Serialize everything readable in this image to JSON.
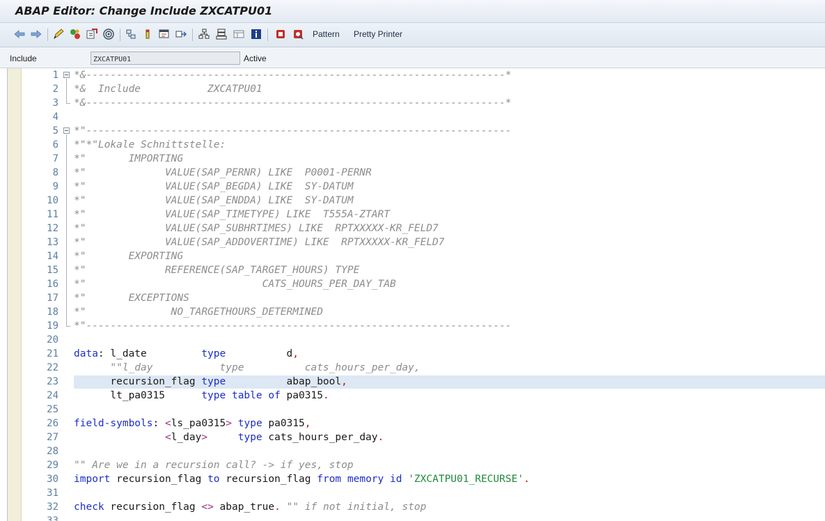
{
  "window": {
    "title": "ABAP Editor: Change Include ZXCATPU01"
  },
  "toolbar": {
    "pattern_label": "Pattern",
    "pretty_printer_label": "Pretty Printer"
  },
  "include": {
    "label": "Include",
    "name": "ZXCATPU01",
    "status": "Active"
  },
  "editor": {
    "lines": [
      {
        "n": "1",
        "fold": "open",
        "tokens": [
          [
            "cmt",
            "*&---------------------------------------------------------------------*"
          ]
        ]
      },
      {
        "n": "2",
        "tokens": [
          [
            "cmt",
            "*&  Include           ZXCATPU01"
          ]
        ]
      },
      {
        "n": "3",
        "fold": "end",
        "tokens": [
          [
            "cmt",
            "*&---------------------------------------------------------------------*"
          ]
        ]
      },
      {
        "n": "4",
        "tokens": []
      },
      {
        "n": "5",
        "fold": "open",
        "tokens": [
          [
            "cmt",
            "*\"----------------------------------------------------------------------"
          ]
        ]
      },
      {
        "n": "6",
        "tokens": [
          [
            "cmt",
            "*\"*\"Lokale Schnittstelle:"
          ]
        ]
      },
      {
        "n": "7",
        "tokens": [
          [
            "cmt",
            "*\"       IMPORTING"
          ]
        ]
      },
      {
        "n": "8",
        "tokens": [
          [
            "cmt",
            "*\"             VALUE(SAP_PERNR) LIKE  P0001-PERNR"
          ]
        ]
      },
      {
        "n": "9",
        "tokens": [
          [
            "cmt",
            "*\"             VALUE(SAP_BEGDA) LIKE  SY-DATUM"
          ]
        ]
      },
      {
        "n": "10",
        "tokens": [
          [
            "cmt",
            "*\"             VALUE(SAP_ENDDA) LIKE  SY-DATUM"
          ]
        ]
      },
      {
        "n": "11",
        "tokens": [
          [
            "cmt",
            "*\"             VALUE(SAP_TIMETYPE) LIKE  T555A-ZTART"
          ]
        ]
      },
      {
        "n": "12",
        "tokens": [
          [
            "cmt",
            "*\"             VALUE(SAP_SUBHRTIMES) LIKE  RPTXXXXX-KR_FELD7"
          ]
        ]
      },
      {
        "n": "13",
        "tokens": [
          [
            "cmt",
            "*\"             VALUE(SAP_ADDOVERTIME) LIKE  RPTXXXXX-KR_FELD7"
          ]
        ]
      },
      {
        "n": "14",
        "tokens": [
          [
            "cmt",
            "*\"       EXPORTING"
          ]
        ]
      },
      {
        "n": "15",
        "tokens": [
          [
            "cmt",
            "*\"             REFERENCE(SAP_TARGET_HOURS) TYPE"
          ]
        ]
      },
      {
        "n": "16",
        "tokens": [
          [
            "cmt",
            "*\"                             CATS_HOURS_PER_DAY_TAB"
          ]
        ]
      },
      {
        "n": "17",
        "tokens": [
          [
            "cmt",
            "*\"       EXCEPTIONS"
          ]
        ]
      },
      {
        "n": "18",
        "tokens": [
          [
            "cmt",
            "*\"              NO_TARGETHOURS_DETERMINED"
          ]
        ]
      },
      {
        "n": "19",
        "fold": "end",
        "tokens": [
          [
            "cmt",
            "*\"----------------------------------------------------------------------"
          ]
        ]
      },
      {
        "n": "20",
        "tokens": []
      },
      {
        "n": "21",
        "tokens": [
          [
            "kw",
            "data"
          ],
          [
            "tx",
            ": l_date         "
          ],
          [
            "kw",
            "type"
          ],
          [
            "tx",
            "          d"
          ],
          [
            "punc",
            ","
          ]
        ]
      },
      {
        "n": "22",
        "tokens": [
          [
            "cmt",
            "      \"\"l_day           type          cats_hours_per_day,"
          ]
        ]
      },
      {
        "n": "23",
        "highlight": true,
        "tokens": [
          [
            "tx",
            "      recursion_flag "
          ],
          [
            "kw",
            "type"
          ],
          [
            "tx",
            "          abap_bool"
          ],
          [
            "punc",
            ","
          ]
        ]
      },
      {
        "n": "24",
        "tokens": [
          [
            "tx",
            "      lt_pa0315      "
          ],
          [
            "kw",
            "type table of"
          ],
          [
            "tx",
            " pa0315"
          ],
          [
            "punc",
            "."
          ]
        ]
      },
      {
        "n": "25",
        "tokens": []
      },
      {
        "n": "26",
        "tokens": [
          [
            "kw",
            "field-symbols"
          ],
          [
            "tx",
            ": "
          ],
          [
            "op",
            "<"
          ],
          [
            "tx",
            "ls_pa0315"
          ],
          [
            "op",
            ">"
          ],
          [
            "tx",
            " "
          ],
          [
            "kw",
            "type"
          ],
          [
            "tx",
            " pa0315"
          ],
          [
            "punc",
            ","
          ]
        ]
      },
      {
        "n": "27",
        "tokens": [
          [
            "tx",
            "               "
          ],
          [
            "op",
            "<"
          ],
          [
            "tx",
            "l_day"
          ],
          [
            "op",
            ">"
          ],
          [
            "tx",
            "     "
          ],
          [
            "kw",
            "type"
          ],
          [
            "tx",
            " cats_hours_per_day"
          ],
          [
            "punc",
            "."
          ]
        ]
      },
      {
        "n": "28",
        "tokens": []
      },
      {
        "n": "29",
        "tokens": [
          [
            "cmt",
            "\"\" Are we in a recursion call? -> if yes, stop"
          ]
        ]
      },
      {
        "n": "30",
        "tokens": [
          [
            "kw",
            "import"
          ],
          [
            "tx",
            " recursion_flag "
          ],
          [
            "kw",
            "to"
          ],
          [
            "tx",
            " recursion_flag "
          ],
          [
            "kw",
            "from memory id"
          ],
          [
            "tx",
            " "
          ],
          [
            "lit",
            "'ZXCATPU01_RECURSE'"
          ],
          [
            "punc",
            "."
          ]
        ]
      },
      {
        "n": "31",
        "tokens": []
      },
      {
        "n": "32",
        "tokens": [
          [
            "kw",
            "check"
          ],
          [
            "tx",
            " recursion_flag "
          ],
          [
            "op",
            "<>"
          ],
          [
            "tx",
            " abap_true"
          ],
          [
            "punc",
            "."
          ],
          [
            "tx",
            " "
          ],
          [
            "cmt",
            "\"\" if not initial, stop"
          ]
        ]
      },
      {
        "n": "33",
        "tokens": []
      }
    ]
  }
}
